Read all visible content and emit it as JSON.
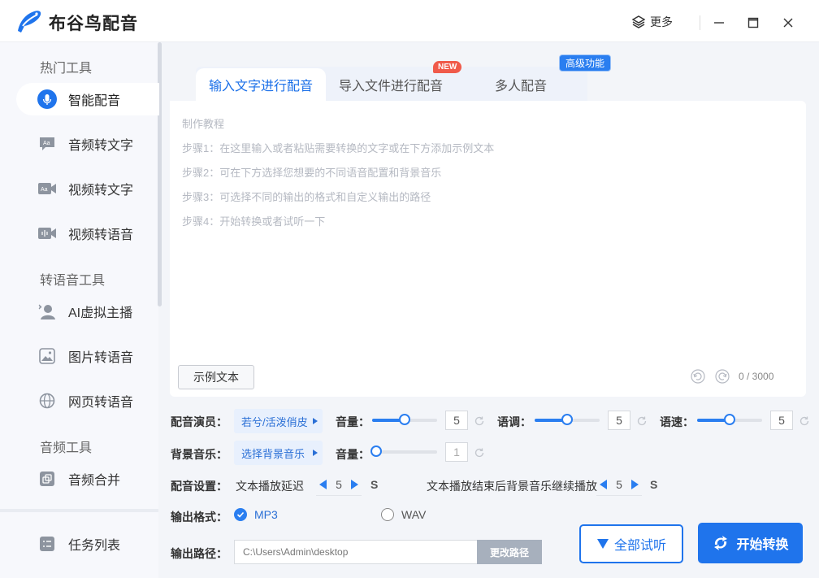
{
  "app": {
    "title": "布谷鸟配音",
    "more_label": "更多"
  },
  "sidebar": {
    "sections": [
      {
        "title": "热门工具"
      },
      {
        "title": "转语音工具"
      },
      {
        "title": "音频工具"
      }
    ],
    "items": [
      {
        "label": "智能配音",
        "icon": "microphone-icon"
      },
      {
        "label": "音频转文字",
        "icon": "audio-text-icon"
      },
      {
        "label": "视频转文字",
        "icon": "video-text-icon"
      },
      {
        "label": "视频转语音",
        "icon": "video-voice-icon"
      },
      {
        "label": "AI虚拟主播",
        "icon": "avatar-icon"
      },
      {
        "label": "图片转语音",
        "icon": "image-icon"
      },
      {
        "label": "网页转语音",
        "icon": "globe-icon"
      },
      {
        "label": "音频合并",
        "icon": "merge-icon"
      },
      {
        "label": "任务列表",
        "icon": "task-list-icon"
      }
    ]
  },
  "tabs": [
    {
      "label": "输入文字进行配音"
    },
    {
      "label": "导入文件进行配音"
    },
    {
      "label": "多人配音"
    }
  ],
  "badges": {
    "new": "NEW",
    "advanced": "高级功能"
  },
  "editor": {
    "hints": [
      "制作教程",
      "步骤1：在这里输入或者粘贴需要转换的文字或在下方添加示例文本",
      "步骤2：可在下方选择您想要的不同语音配置和背景音乐",
      "步骤3：可选择不同的输出的格式和自定义输出的路径",
      "步骤4：开始转换或者试听一下"
    ],
    "sample_button": "示例文本",
    "counter": "0 / 3000"
  },
  "voice": {
    "label": "配音演员：",
    "selected": "若兮/活泼俏皮",
    "volume_label": "音量：",
    "volume": 5,
    "volume_fraction": 0.5,
    "tone_label": "语调：",
    "tone": 5,
    "tone_fraction": 0.5,
    "speed_label": "语速：",
    "speed": 5,
    "speed_fraction": 0.5
  },
  "bgm": {
    "label": "背景音乐：",
    "selected": "选择背景音乐",
    "volume_label": "音量：",
    "volume": 1,
    "volume_fraction": 0.0
  },
  "settings": {
    "label": "配音设置：",
    "delay_label": "文本播放延迟",
    "delay": 5,
    "unit": "S",
    "continue_label": "文本播放结束后背景音乐继续播放",
    "continue": 5
  },
  "format": {
    "label": "输出格式：",
    "options": [
      "MP3",
      "WAV"
    ],
    "selected": "MP3"
  },
  "path": {
    "label": "输出路径：",
    "value": "C:\\Users\\Admin\\desktop",
    "change_button": "更改路径"
  },
  "actions": {
    "listen": "全部试听",
    "start": "开始转换"
  },
  "colors": {
    "accent": "#1f74ec",
    "badge_new": "#f05a4a"
  }
}
